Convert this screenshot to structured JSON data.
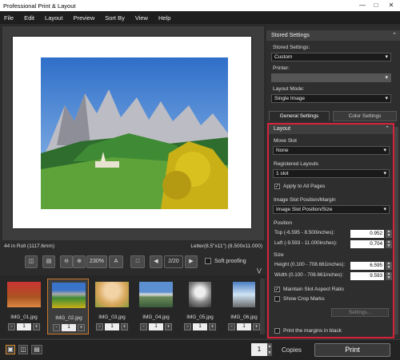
{
  "app": {
    "title": "Professional Print & Layout"
  },
  "menu": [
    "File",
    "Edit",
    "Layout",
    "Preview",
    "Sort By",
    "View",
    "Help"
  ],
  "preview": {
    "roll_info": "44 in Roll (1117.6mm)",
    "paper_info": "Letter(8.5\"x11\") (8.500x11.000)"
  },
  "toolbar": {
    "zoom": "230%",
    "page": "2/20",
    "soft_proofing": "Soft proofing"
  },
  "thumbnails": [
    {
      "name": "IMG_01.jpg",
      "count": "1"
    },
    {
      "name": "IMG_02.jpg",
      "count": "1"
    },
    {
      "name": "IMG_03.jpg",
      "count": "1"
    },
    {
      "name": "IMG_04.jpg",
      "count": "1"
    },
    {
      "name": "IMG_05.jpg",
      "count": "1"
    },
    {
      "name": "IMG_06.jpg",
      "count": "1"
    }
  ],
  "bottom": {
    "copies_value": "1",
    "copies_label": "Copies",
    "print_label": "Print"
  },
  "stored": {
    "header": "Stored Settings",
    "stored_label": "Stored Settings:",
    "stored_value": "Custom",
    "printer_label": "Printer:",
    "printer_value": "",
    "layout_mode_label": "Layout Mode:",
    "layout_mode_value": "Single Image"
  },
  "tabs": {
    "general": "General Settings",
    "color": "Color Settings"
  },
  "layout": {
    "header": "Layout",
    "move_slot_label": "Move Slot",
    "move_slot_value": "None",
    "registered_label": "Registered Layouts",
    "registered_value": "1 slot",
    "apply_all": "Apply to All Pages",
    "slot_pos_label": "Image Slot Position/Margin",
    "slot_pos_value": "Image Slot Position/Size",
    "position_label": "Position",
    "top_label": "Top (-6.595 - 8.500inches):",
    "top_value": "0.952",
    "left_label": "Left (-9.593 - 11.000inches):",
    "left_value": "0.704",
    "size_label": "Size",
    "height_label": "Height (0.100 - 708.661inches):",
    "height_value": "6.595",
    "width_label": "Width (0.100 - 708.661inches):",
    "width_value": "9.593",
    "maintain": "Maintain Slot Aspect Ratio",
    "crop": "Show Crop Marks",
    "settings_btn": "Settings...",
    "print_margins": "Print the margins in black"
  },
  "colors": {
    "accent": "#d7223c"
  }
}
